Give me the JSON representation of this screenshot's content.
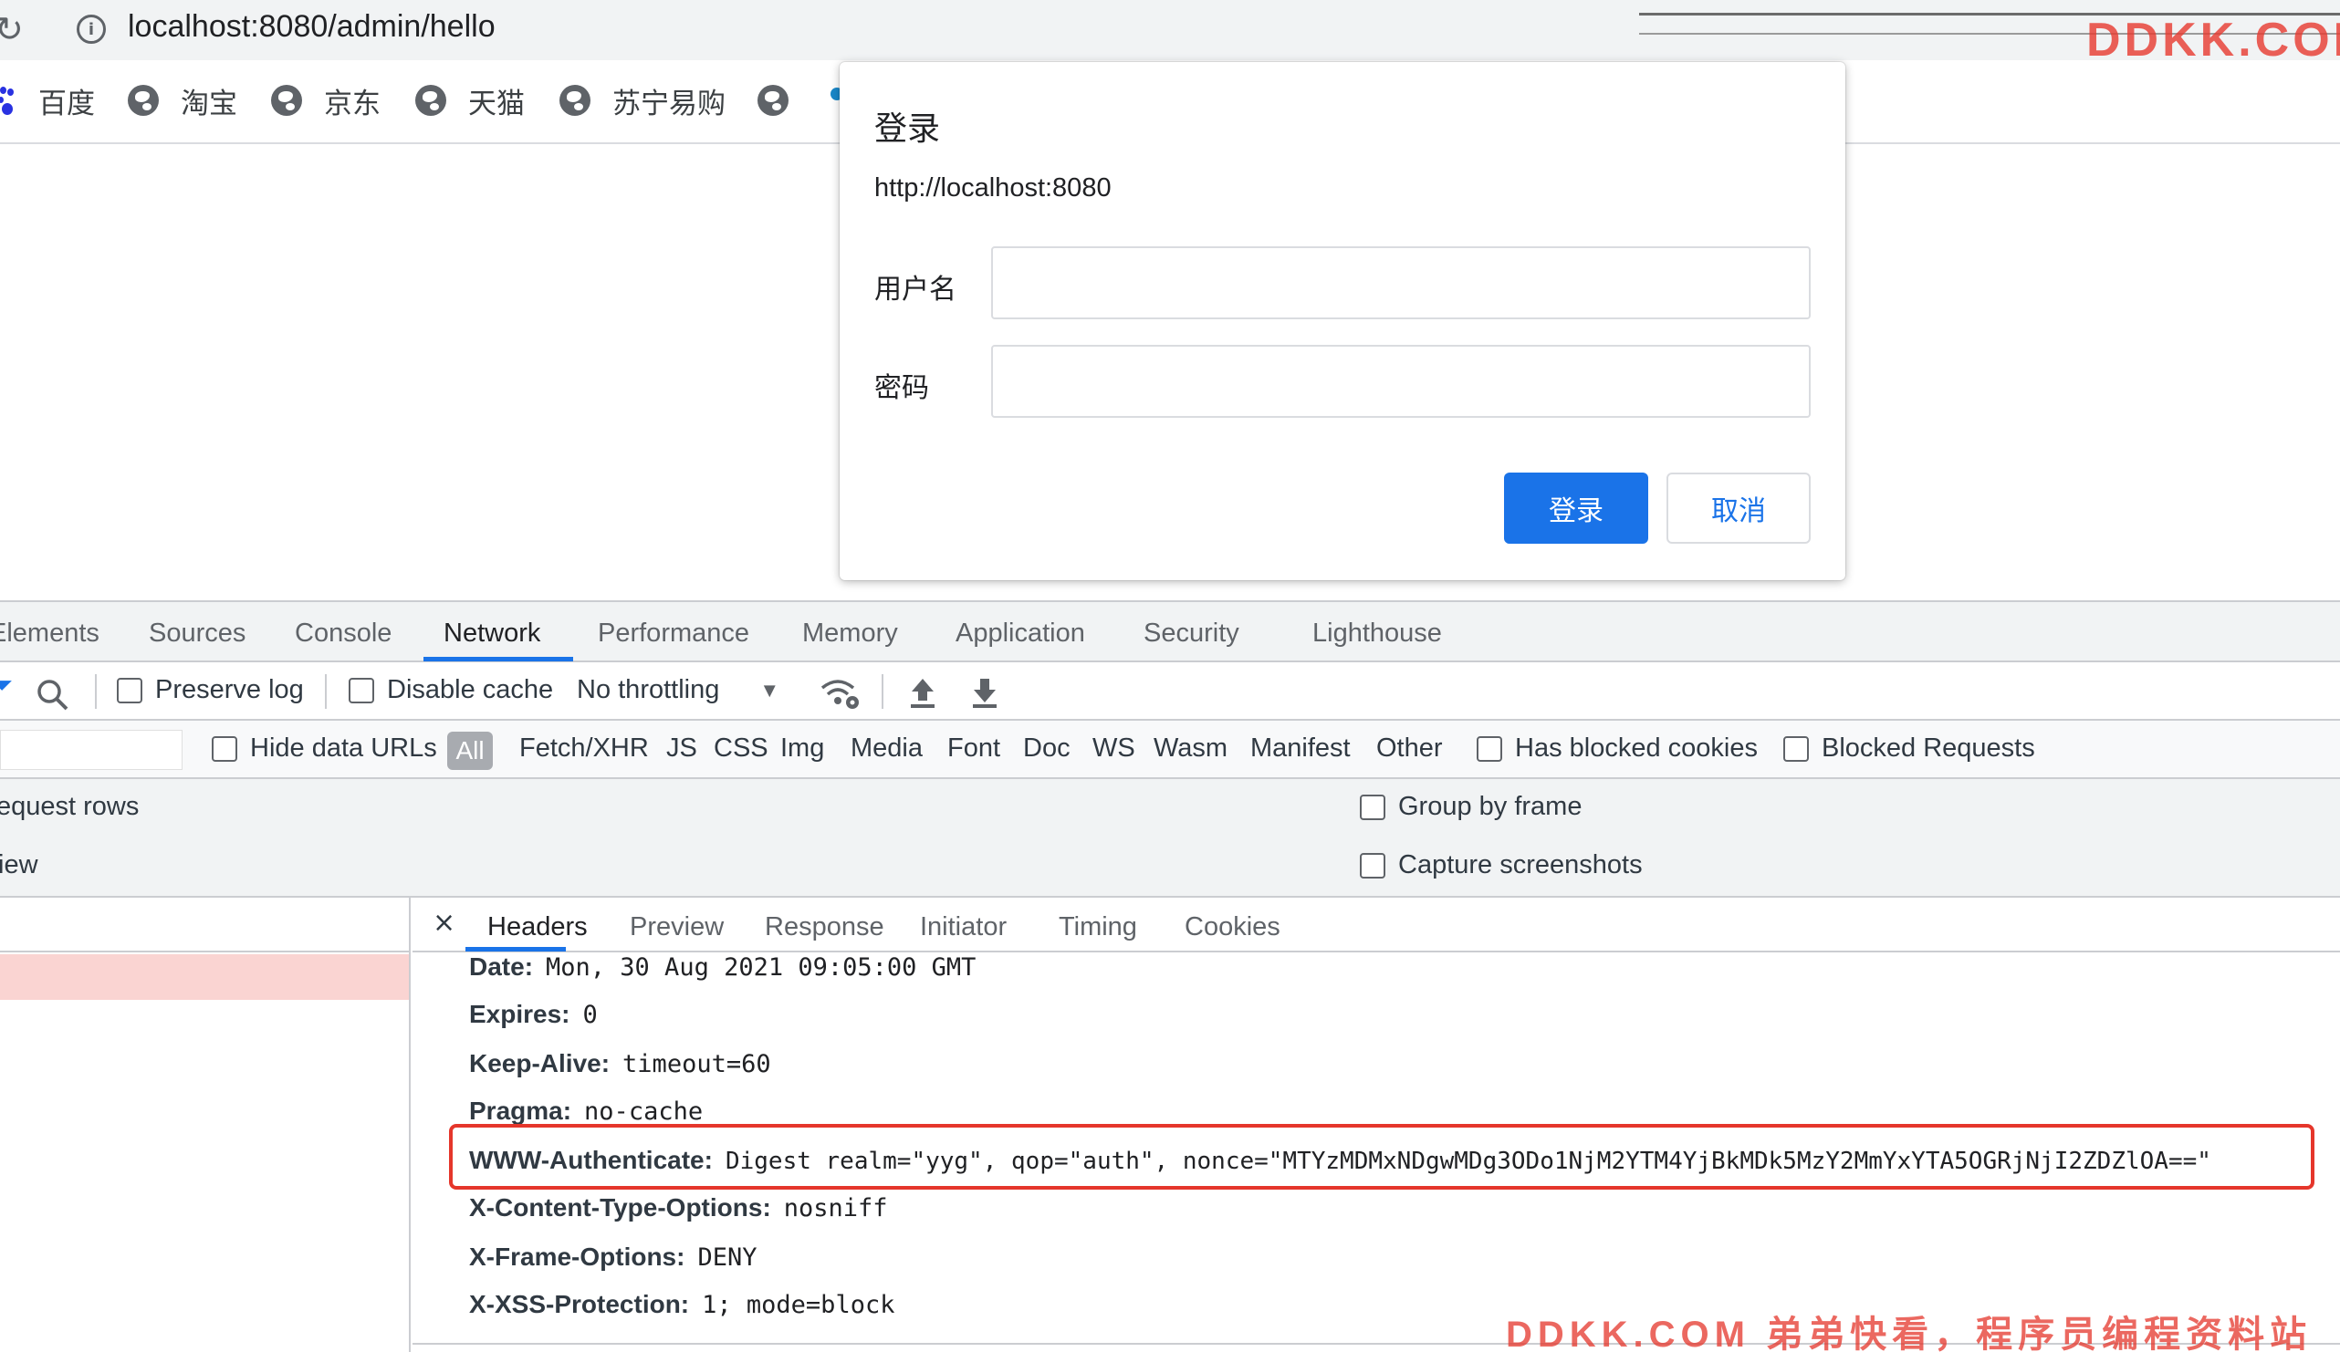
{
  "browser": {
    "url": "localhost:8080/admin/hello",
    "bookmarks": [
      "百度",
      "淘宝",
      "京东",
      "天猫",
      "苏宁易购"
    ],
    "watermark": "DDKK.COM"
  },
  "dialog": {
    "title": "登录",
    "origin": "http://localhost:8080",
    "username_label": "用户名",
    "password_label": "密码",
    "username_value": "",
    "password_value": "",
    "login_button": "登录",
    "cancel_button": "取消",
    "accent": "#1a73e8"
  },
  "devtools": {
    "tabs": [
      "Elements",
      "Sources",
      "Console",
      "Network",
      "Performance",
      "Memory",
      "Application",
      "Security",
      "Lighthouse"
    ],
    "active_tab": "Network",
    "toolbar": {
      "preserve_log": "Preserve log",
      "disable_cache": "Disable cache",
      "throttling": "No throttling"
    },
    "filters": {
      "hide_data_urls": "Hide data URLs",
      "types": [
        "All",
        "Fetch/XHR",
        "JS",
        "CSS",
        "Img",
        "Media",
        "Font",
        "Doc",
        "WS",
        "Wasm",
        "Manifest",
        "Other"
      ],
      "has_blocked_cookies": "Has blocked cookies",
      "blocked_requests": "Blocked Requests"
    },
    "settings": {
      "big_request_rows": "equest rows",
      "overview": "iew",
      "group_by_frame": "Group by frame",
      "capture_screenshots": "Capture screenshots"
    },
    "detail_tabs": [
      "Headers",
      "Preview",
      "Response",
      "Initiator",
      "Timing",
      "Cookies"
    ],
    "active_detail_tab": "Headers",
    "close_glyph": "×",
    "response_headers": [
      {
        "name": "Date:",
        "value": "Mon, 30 Aug 2021 09:05:00 GMT"
      },
      {
        "name": "Expires:",
        "value": "0"
      },
      {
        "name": "Keep-Alive:",
        "value": "timeout=60"
      },
      {
        "name": "Pragma:",
        "value": "no-cache"
      },
      {
        "name": "WWW-Authenticate:",
        "value": "Digest realm=\"yyg\", qop=\"auth\", nonce=\"MTYzMDMxNDgwMDg3ODo1NjM2YTM4YjBkMDk5MzY2MmYxYTA5OGRjNjI2ZDZlOA==\""
      },
      {
        "name": "X-Content-Type-Options:",
        "value": "nosniff"
      },
      {
        "name": "X-Frame-Options:",
        "value": "DENY"
      },
      {
        "name": "X-XSS-Protection:",
        "value": "1; mode=block"
      }
    ],
    "highlight_color": "#e5362b",
    "bottom_watermark": "DDKK.COM 弟弟快看，程序员编程资料站"
  }
}
